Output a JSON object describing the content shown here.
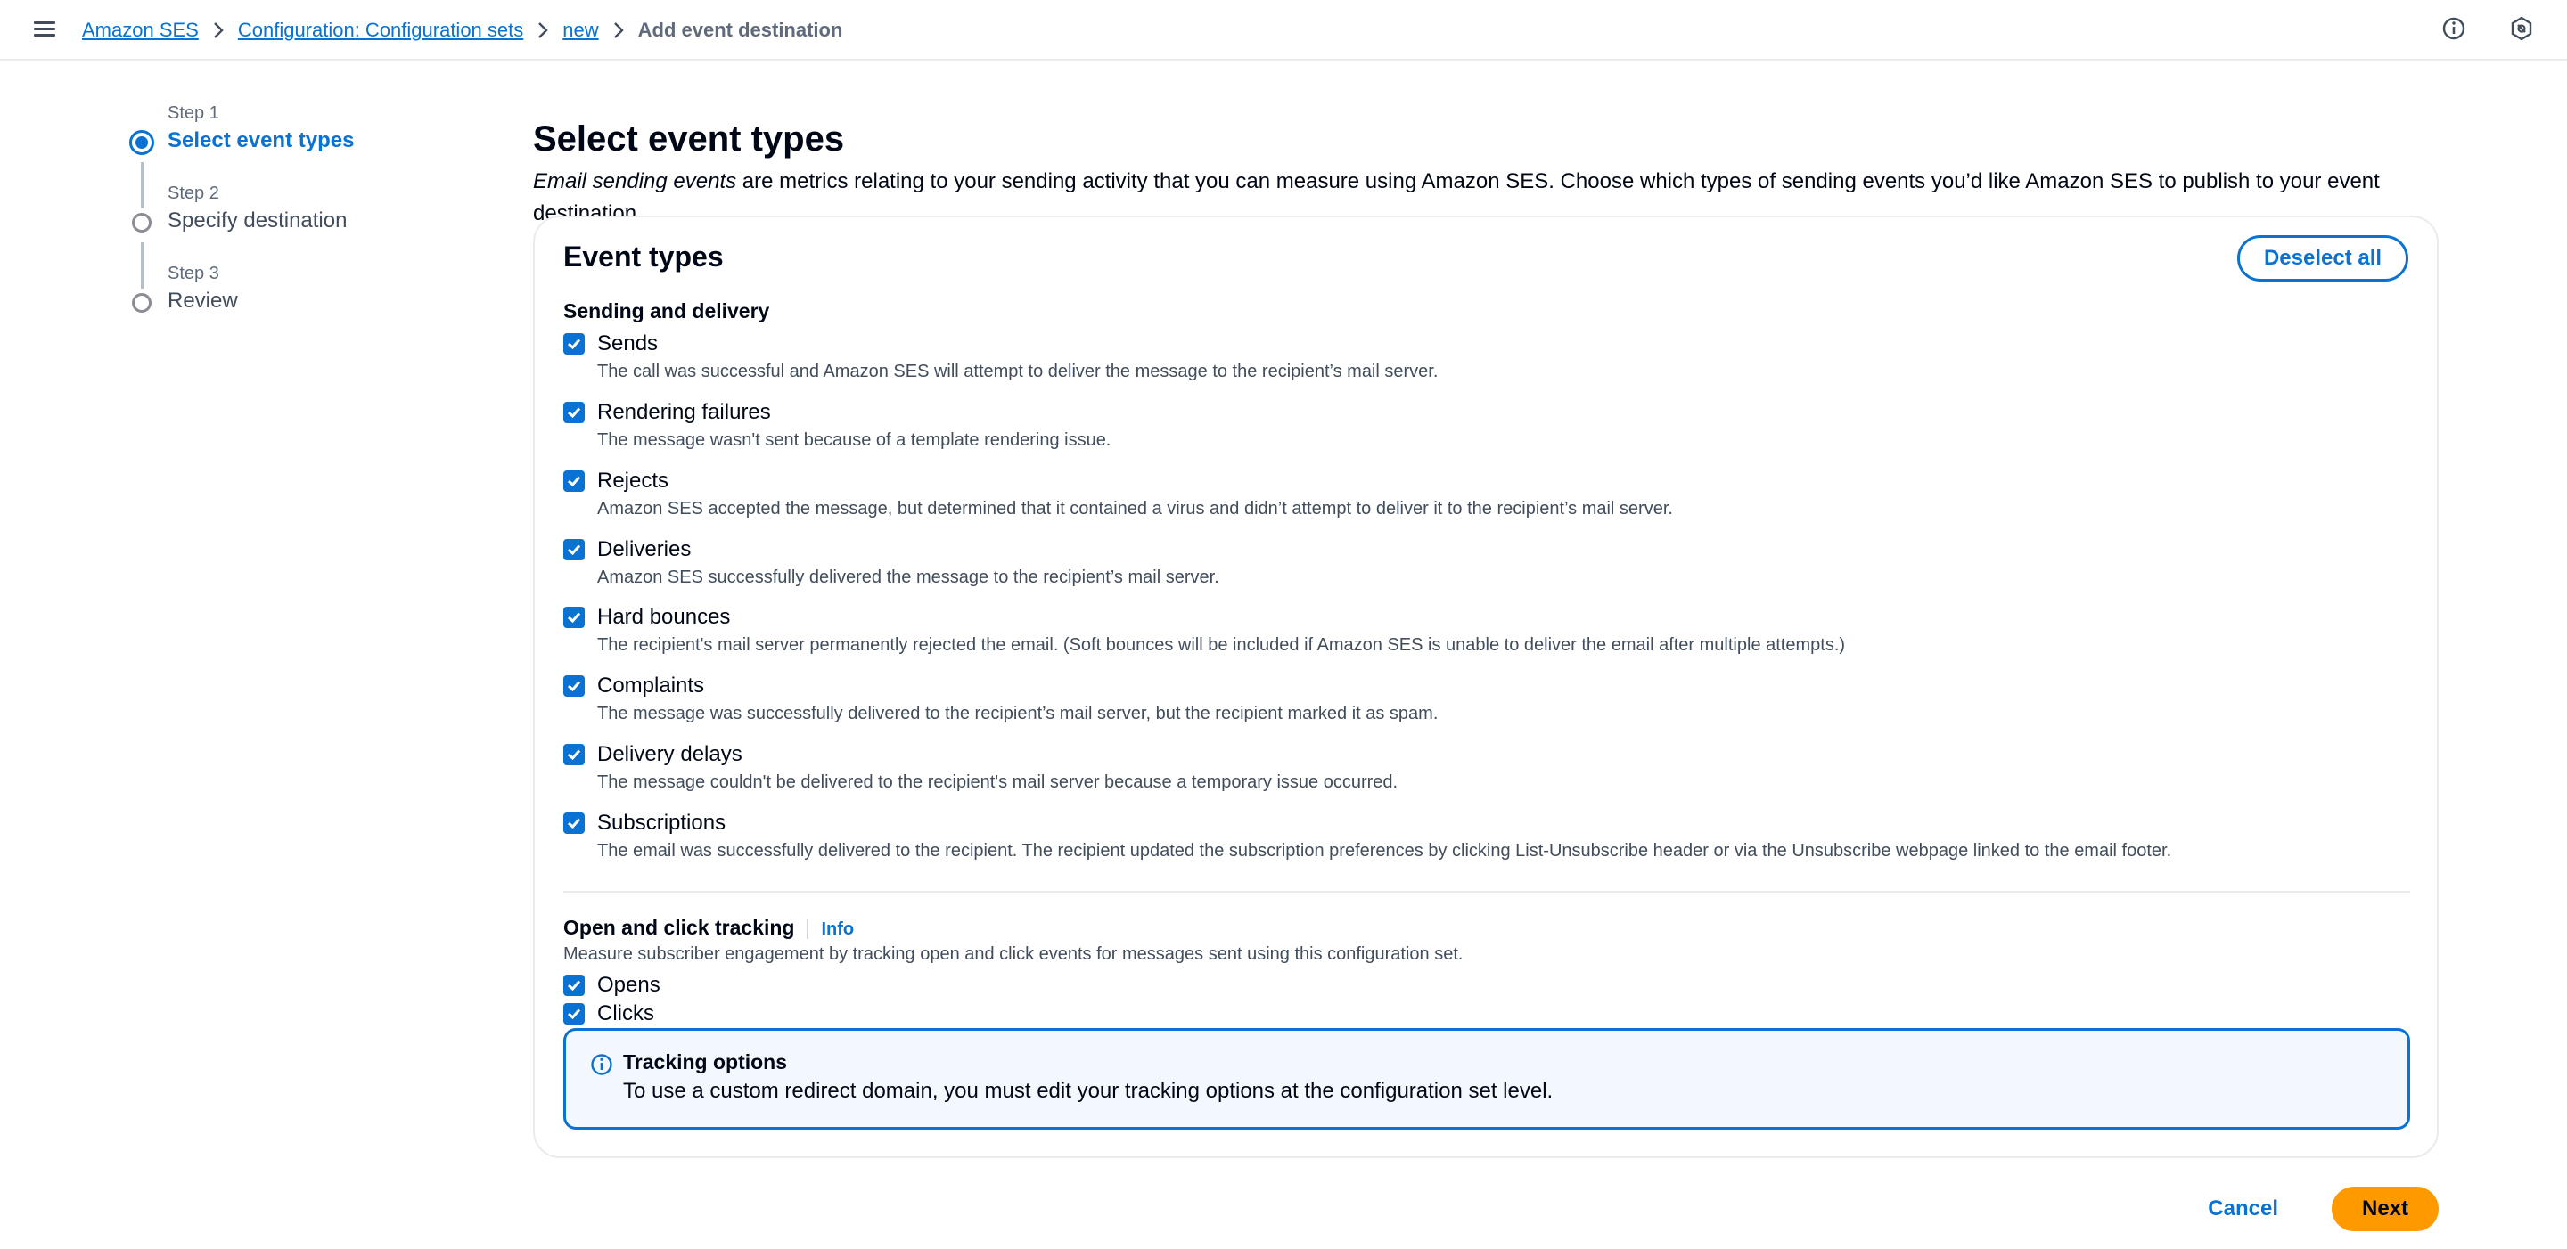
{
  "breadcrumb": {
    "items": [
      "Amazon SES",
      "Configuration: Configuration sets",
      "new"
    ],
    "current": "Add event destination"
  },
  "icons": {
    "menu": "hamburger-icon",
    "info": "info-circle-icon",
    "settings": "hexagon-settings-icon",
    "checkbox": "check-icon",
    "alert": "info-circle-icon"
  },
  "colors": {
    "accent": "#0972d3",
    "primary_button": "#ff9900"
  },
  "steps": [
    {
      "num": "Step 1",
      "title": "Select event types",
      "active": true
    },
    {
      "num": "Step 2",
      "title": "Specify destination",
      "active": false
    },
    {
      "num": "Step 3",
      "title": "Review",
      "active": false
    }
  ],
  "page": {
    "title": "Select event types",
    "desc_em": "Email sending events",
    "desc_rest": " are metrics relating to your sending activity that you can measure using Amazon SES. Choose which types of sending events you’d like Amazon SES to publish to your event destination."
  },
  "card": {
    "title": "Event types",
    "deselect_label": "Deselect all",
    "sending_section": "Sending and delivery",
    "events": [
      {
        "label": "Sends",
        "desc": "The call was successful and Amazon SES will attempt to deliver the message to the recipient’s mail server.",
        "checked": true
      },
      {
        "label": "Rendering failures",
        "desc": "The message wasn't sent because of a template rendering issue.",
        "checked": true
      },
      {
        "label": "Rejects",
        "desc": "Amazon SES accepted the message, but determined that it contained a virus and didn’t attempt to deliver it to the recipient’s mail server.",
        "checked": true
      },
      {
        "label": "Deliveries",
        "desc": "Amazon SES successfully delivered the message to the recipient’s mail server.",
        "checked": true
      },
      {
        "label": "Hard bounces",
        "desc": "The recipient's mail server permanently rejected the email. (Soft bounces will be included if Amazon SES is unable to deliver the email after multiple attempts.)",
        "checked": true
      },
      {
        "label": "Complaints",
        "desc": "The message was successfully delivered to the recipient’s mail server, but the recipient marked it as spam.",
        "checked": true
      },
      {
        "label": "Delivery delays",
        "desc": "The message couldn't be delivered to the recipient's mail server because a temporary issue occurred.",
        "checked": true
      },
      {
        "label": "Subscriptions",
        "desc": "The email was successfully delivered to the recipient. The recipient updated the subscription preferences by clicking List-Unsubscribe header or via the Unsubscribe webpage linked to the email footer.",
        "checked": true
      }
    ],
    "tracking_section": "Open and click tracking",
    "info_link": "Info",
    "tracking_desc": "Measure subscriber engagement by tracking open and click events for messages sent using this configuration set.",
    "tracking_items": [
      {
        "label": "Opens",
        "checked": true
      },
      {
        "label": "Clicks",
        "checked": true
      }
    ],
    "alert": {
      "title": "Tracking options",
      "body": "To use a custom redirect domain, you must edit your tracking options at the configuration set level."
    }
  },
  "footer": {
    "cancel_label": "Cancel",
    "next_label": "Next"
  }
}
